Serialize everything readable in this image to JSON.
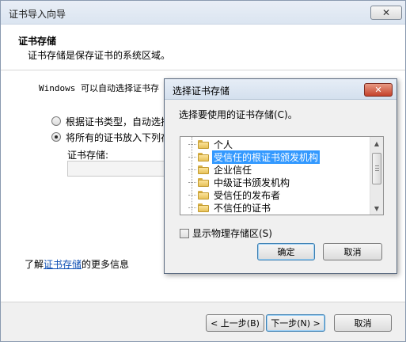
{
  "window": {
    "title": "证书导入向导",
    "close_glyph": "✕"
  },
  "header": {
    "title": "证书存储",
    "subtitle": "证书存储是保存证书的系统区域。"
  },
  "content": {
    "intro": "Windows 可以自动选择证书存",
    "radio_auto": {
      "label": "根据证书类型，自动选择",
      "checked": false
    },
    "radio_manual": {
      "label": "将所有的证书放入下列存",
      "checked": true
    },
    "store_label": "证书存储:",
    "store_value": "",
    "learn_prefix": "了解",
    "learn_link": "证书存储",
    "learn_suffix": "的更多信息"
  },
  "footer": {
    "back_label": "< 上一步(B)",
    "next_label": "下一步(N) >",
    "cancel_label": "取消"
  },
  "dialog": {
    "title": "选择证书存储",
    "close_glyph": "✕",
    "prompt": "选择要使用的证书存储(C)。",
    "stores": [
      {
        "label": "个人",
        "selected": false
      },
      {
        "label": "受信任的根证书颁发机构",
        "selected": true
      },
      {
        "label": "企业信任",
        "selected": false
      },
      {
        "label": "中级证书颁发机构",
        "selected": false
      },
      {
        "label": "受信任的发布者",
        "selected": false
      },
      {
        "label": "不信任的证书",
        "selected": false
      }
    ],
    "scroll_up_glyph": "▲",
    "scroll_down_glyph": "▼",
    "show_physical_label": "显示物理存储区(S)",
    "show_physical_checked": false,
    "ok_label": "确定",
    "cancel_label": "取消"
  },
  "colors": {
    "selection": "#3399ff",
    "link": "#0f4fb4",
    "folder": "#e7c25a"
  }
}
